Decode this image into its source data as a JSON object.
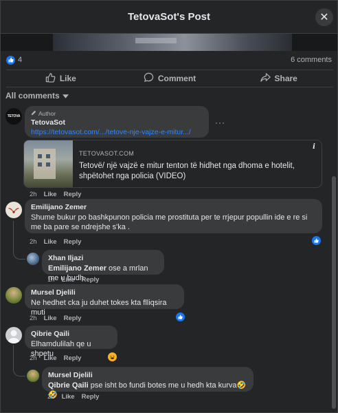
{
  "header": {
    "title": "TetovaSot's Post",
    "close_label": "✕"
  },
  "stats": {
    "likes": "4",
    "comments": "6 comments"
  },
  "actions": {
    "like": "Like",
    "comment": "Comment",
    "share": "Share"
  },
  "filter": {
    "label": "All comments"
  },
  "meta_labels": {
    "like": "Like",
    "reply": "Reply"
  },
  "post_comment": {
    "author_badge": "Author",
    "name": "TetovaSot",
    "link": "https://tetovasot.com/.../tetove-nje-vajze-e-mitur.../",
    "more": "···",
    "avatar_text": "TETOVA",
    "time": "2h",
    "card": {
      "domain": "TETOVASOT.COM",
      "title": "Tetovë/ një vajzë e mitur tenton të hidhet nga dhoma e hotelit, shpëtohet nga policia (VIDEO)",
      "info": "i"
    }
  },
  "comments": [
    {
      "name": "Emilijano Zemer",
      "text": "Shume bukur po bashkpunon policia me prostituta per te rrjepur popullin ide e re si me ba pare se ndrejshe s'ka .",
      "time": "2h"
    },
    {
      "name": "Xhan Iljazi",
      "mention": "Emilijano Zemer",
      "text": " ose a mrlan me u hudh",
      "time": "1h"
    },
    {
      "name": "Mursel Djelili",
      "text": "Ne hedhet cka ju duhet tokes kta flliqsira muti",
      "time": "2h"
    },
    {
      "name": "Qibrie Qaili",
      "text": "Elhamdulilah qe u shpetu",
      "time": "2h"
    },
    {
      "name": "Mursel Djelili",
      "mention": "Qibrie Qaili",
      "text": " pse isht bo fundi botes me u hedh kta kurva🤣🤣",
      "time": "2h"
    }
  ],
  "colors": {
    "accent": "#1877f2",
    "link": "#2d88ff",
    "background": "#242526",
    "bubble": "#3a3b3c"
  }
}
